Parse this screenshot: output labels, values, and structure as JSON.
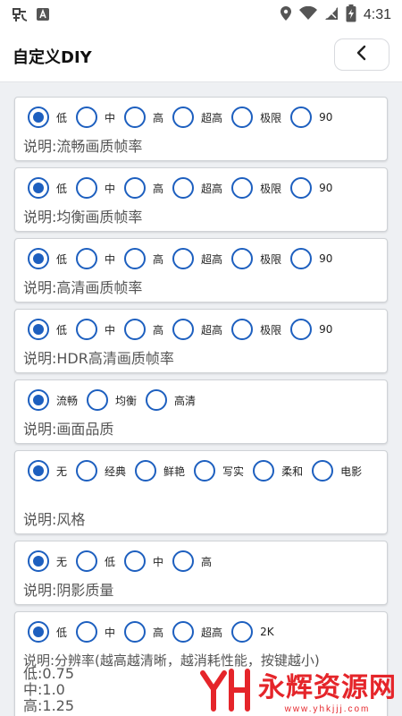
{
  "status_bar": {
    "time": "4:31",
    "icons": [
      "bug-icon",
      "text-input-icon",
      "location-icon",
      "wifi-icon",
      "signal-icon",
      "battery-charging-icon"
    ]
  },
  "app_bar": {
    "title": "自定义DIY",
    "back_icon": "chevron-left-icon"
  },
  "colors": {
    "radio": "#1d5fbf",
    "watermark": "#e5252a"
  },
  "cards": [
    {
      "options": [
        "低",
        "中",
        "高",
        "超高",
        "极限",
        "90"
      ],
      "selected": 0,
      "description": "说明:流畅画质帧率"
    },
    {
      "options": [
        "低",
        "中",
        "高",
        "超高",
        "极限",
        "90"
      ],
      "selected": 0,
      "description": "说明:均衡画质帧率"
    },
    {
      "options": [
        "低",
        "中",
        "高",
        "超高",
        "极限",
        "90"
      ],
      "selected": 0,
      "description": "说明:高清画质帧率"
    },
    {
      "options": [
        "低",
        "中",
        "高",
        "超高",
        "极限",
        "90"
      ],
      "selected": 0,
      "description": "说明:HDR高清画质帧率"
    },
    {
      "options": [
        "流畅",
        "均衡",
        "高清"
      ],
      "selected": 0,
      "description": "说明:画面品质"
    },
    {
      "options": [
        "无",
        "经典",
        "鲜艳",
        "写实",
        "柔和",
        "电影"
      ],
      "selected": 0,
      "description": "说明:风格"
    },
    {
      "options": [
        "无",
        "低",
        "中",
        "高"
      ],
      "selected": 0,
      "description": "说明:阴影质量"
    },
    {
      "options": [
        "低",
        "中",
        "高",
        "超高",
        "2K"
      ],
      "selected": 0,
      "description": "说明:分辨率(越高越清晰，越消耗性能，按键越小)",
      "values": [
        "低:0.75",
        "中:1.0",
        "高:1.25"
      ]
    }
  ],
  "watermark": {
    "text": "永辉资源网",
    "url": "www.yhkjjj.com"
  }
}
